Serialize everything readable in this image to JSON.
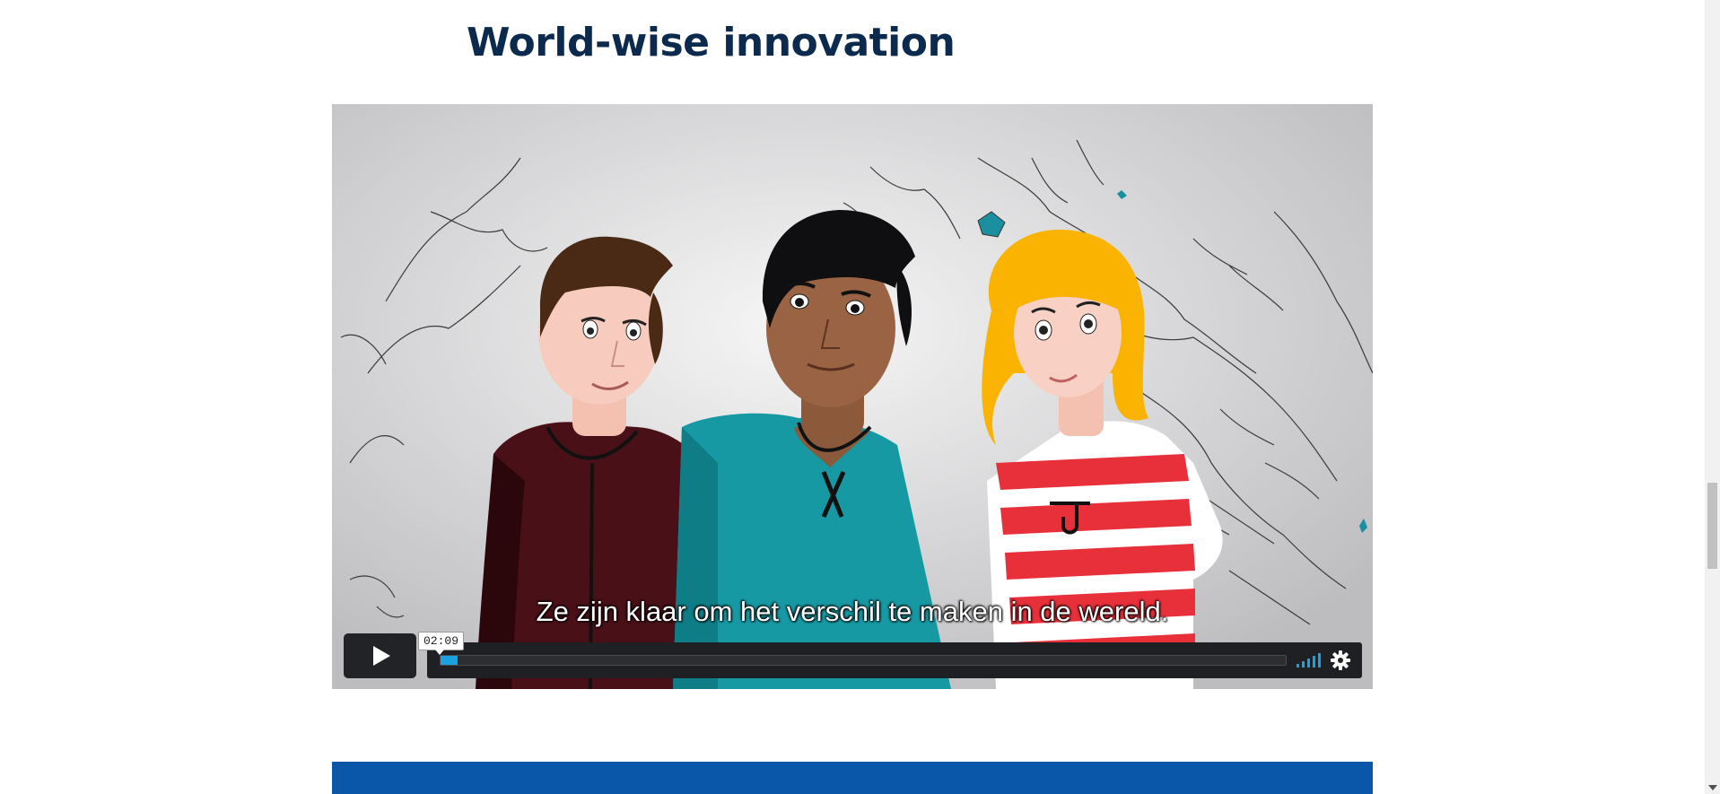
{
  "page": {
    "title": "World-wise innovation"
  },
  "video": {
    "subtitle": "Ze zijn klaar om het verschil te maken in de wereld.",
    "time_tooltip": "02:09",
    "progress_fraction": 0.002,
    "play_icon": "play-icon",
    "volume_icon": "volume-icon",
    "settings_icon": "gear-icon",
    "accent_color": "#1aa1e0"
  },
  "colors": {
    "title": "#0b2a4e",
    "banner": "#0a56a8",
    "control_bg": "#1f2023"
  }
}
